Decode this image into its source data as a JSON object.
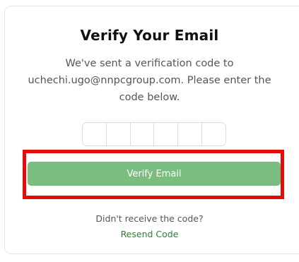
{
  "card": {
    "title": "Verify Your Email",
    "description": "We've sent a verification code to uchechi.ugo@nnpcgroup.com. Please enter the code below."
  },
  "code": {
    "digits": [
      "",
      "",
      "",
      "",
      "",
      ""
    ]
  },
  "actions": {
    "verify_label": "Verify Email",
    "prompt": "Didn't receive the code?",
    "resend_label": "Resend Code"
  },
  "colors": {
    "button": "#7bbd7f",
    "link": "#2e7d32",
    "highlight": "#e30b0b"
  }
}
